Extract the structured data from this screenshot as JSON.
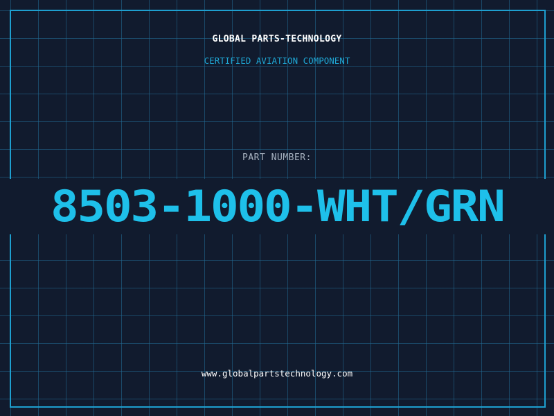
{
  "header": {
    "company": "GLOBAL PARTS-TECHNOLOGY",
    "subtitle": "CERTIFIED AVIATION COMPONENT"
  },
  "part": {
    "label": "PART NUMBER:",
    "number": "8503-1000-WHT/GRN"
  },
  "footer": {
    "website": "www.globalpartstechnology.com"
  },
  "colors": {
    "background": "#111b2e",
    "grid": "#226e96",
    "accent": "#1ec0ea",
    "frame": "#1e9fcf"
  }
}
